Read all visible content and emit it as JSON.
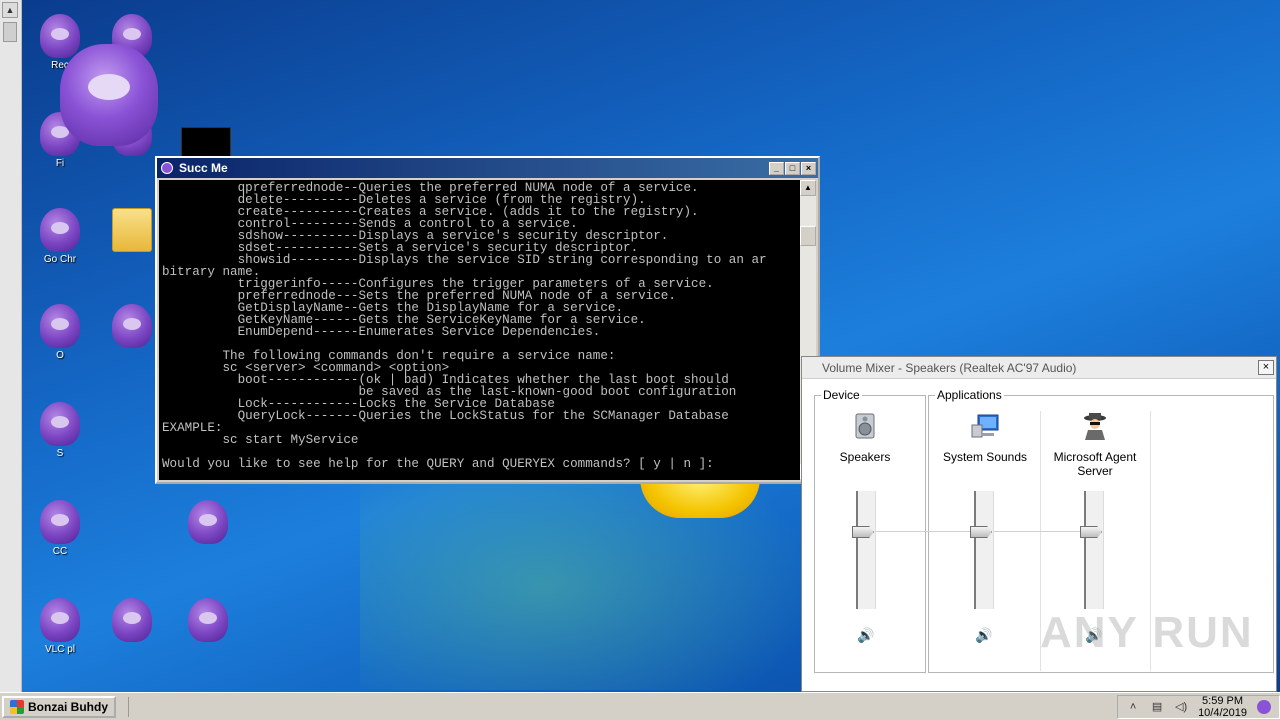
{
  "console": {
    "title": "Succ Me",
    "lines": [
      "          qpreferrednode--Queries the preferred NUMA node of a service.",
      "          delete----------Deletes a service (from the registry).",
      "          create----------Creates a service. (adds it to the registry).",
      "          control---------Sends a control to a service.",
      "          sdshow----------Displays a service's security descriptor.",
      "          sdset-----------Sets a service's security descriptor.",
      "          showsid---------Displays the service SID string corresponding to an ar",
      "bitrary name.",
      "          triggerinfo-----Configures the trigger parameters of a service.",
      "          preferrednode---Sets the preferred NUMA node of a service.",
      "          GetDisplayName--Gets the DisplayName for a service.",
      "          GetKeyName------Gets the ServiceKeyName for a service.",
      "          EnumDepend------Enumerates Service Dependencies.",
      "",
      "        The following commands don't require a service name:",
      "        sc <server> <command> <option>",
      "          boot------------(ok | bad) Indicates whether the last boot should",
      "                          be saved as the last-known-good boot configuration",
      "          Lock------------Locks the Service Database",
      "          QueryLock-------Queries the LockStatus for the SCManager Database",
      "EXAMPLE:",
      "        sc start MyService",
      "",
      "Would you like to see help for the QUERY and QUERYEX commands? [ y | n ]:"
    ],
    "minimize_label": "_",
    "maximize_label": "□",
    "close_label": "×"
  },
  "mixer": {
    "title": "Volume Mixer - Speakers (Realtek AC'97 Audio)",
    "close_label": "×",
    "device_group": "Device",
    "applications_group": "Applications",
    "channels": [
      {
        "name": "Speakers",
        "icon": "speaker-icon",
        "level": 0.67
      },
      {
        "name": "System Sounds",
        "icon": "system-sounds-icon",
        "level": 0.67
      },
      {
        "name": "Microsoft Agent\nServer",
        "icon": "agent-icon",
        "level": 0.67
      }
    ],
    "mute_glyph": "🔊"
  },
  "desktop": {
    "icons": [
      {
        "label": "Rec"
      },
      {
        "label": "Fi"
      },
      {
        "label": "Go Chr"
      },
      {
        "label": "O"
      },
      {
        "label": "S"
      },
      {
        "label": "CC"
      },
      {
        "label": "VLC pl"
      }
    ]
  },
  "watermark": "ANY RUN",
  "taskbar": {
    "start_label": "Bonzai Buhdy",
    "time": "5:59 PM",
    "date": "10/4/2019"
  }
}
